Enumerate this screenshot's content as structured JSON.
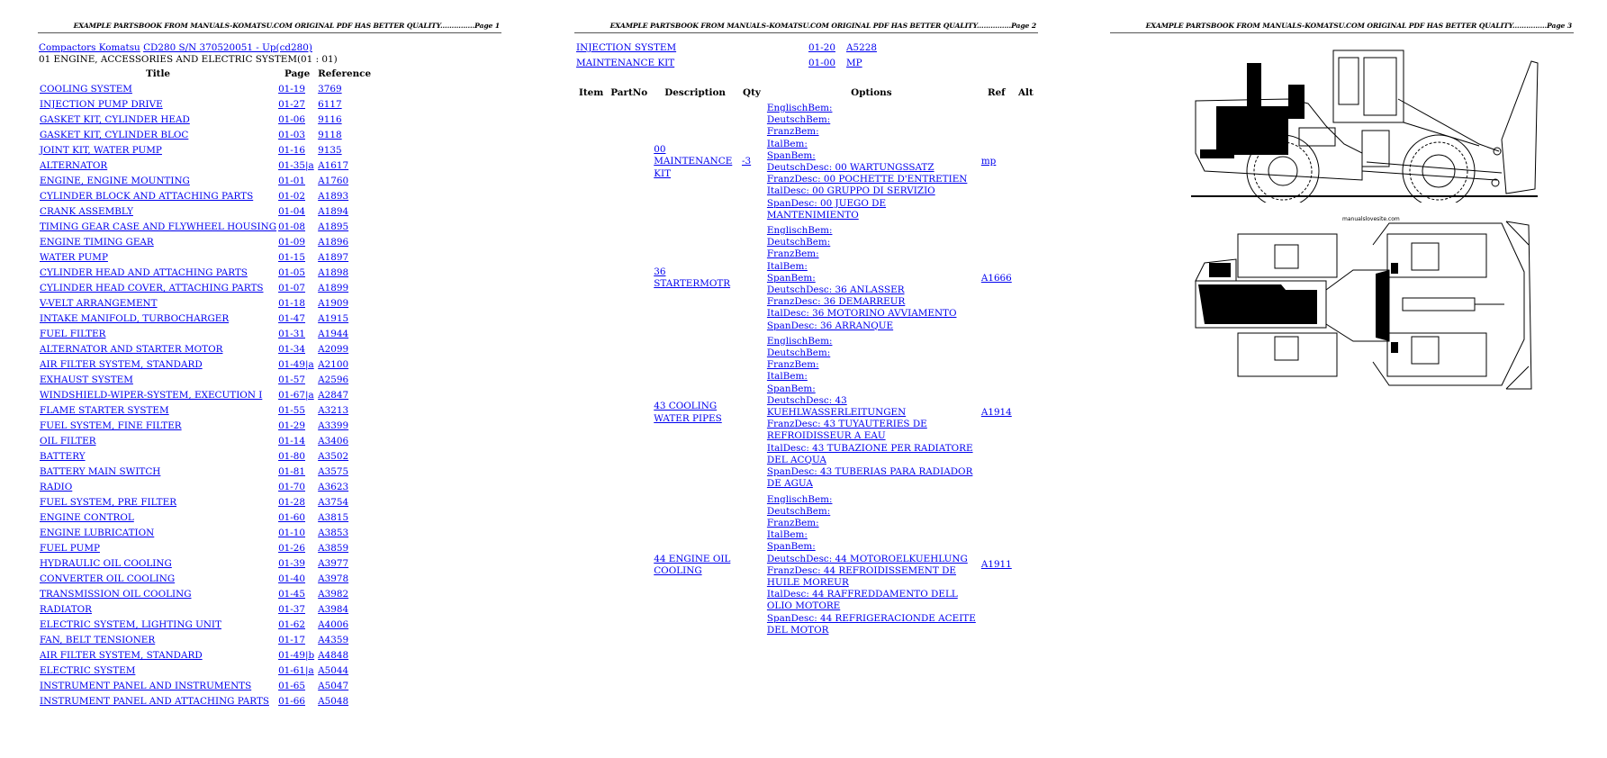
{
  "pages": [
    {
      "header": "EXAMPLE PARTSBOOK FROM MANUALS-KOMATSU.COM ORIGINAL PDF HAS BETTER QUALITY...............Page 1",
      "breadcrumb": {
        "category": "Compactors Komatsu",
        "model": "CD280 S/N 370520051 - Up(cd280)"
      },
      "section_title": "01 ENGINE, ACCESSORIES AND ELECTRIC SYSTEM(01 : 01)",
      "columns": {
        "title": "Title",
        "page": "Page",
        "reference": "Reference"
      },
      "rows": [
        {
          "title": "COOLING SYSTEM",
          "page": "01-19",
          "ref": "3769"
        },
        {
          "title": "INJECTION PUMP DRIVE",
          "page": "01-27",
          "ref": "6117"
        },
        {
          "title": "GASKET KIT, CYLINDER HEAD",
          "page": "01-06",
          "ref": "9116"
        },
        {
          "title": "GASKET KIT, CYLINDER BLOC",
          "page": "01-03",
          "ref": "9118"
        },
        {
          "title": "JOINT KIT, WATER PUMP",
          "page": "01-16",
          "ref": "9135"
        },
        {
          "title": "ALTERNATOR",
          "page": "01-35|a",
          "ref": "A1617"
        },
        {
          "title": "ENGINE, ENGINE MOUNTING",
          "page": "01-01",
          "ref": "A1760"
        },
        {
          "title": "CYLINDER BLOCK AND ATTACHING PARTS",
          "page": "01-02",
          "ref": "A1893"
        },
        {
          "title": "CRANK ASSEMBLY",
          "page": "01-04",
          "ref": "A1894"
        },
        {
          "title": "TIMING GEAR CASE AND FLYWHEEL HOUSING",
          "page": "01-08",
          "ref": "A1895"
        },
        {
          "title": "ENGINE TIMING GEAR",
          "page": "01-09",
          "ref": "A1896"
        },
        {
          "title": "WATER PUMP",
          "page": "01-15",
          "ref": "A1897"
        },
        {
          "title": "CYLINDER HEAD AND ATTACHING PARTS",
          "page": "01-05",
          "ref": "A1898"
        },
        {
          "title": "CYLINDER HEAD COVER, ATTACHING PARTS",
          "page": "01-07",
          "ref": "A1899"
        },
        {
          "title": "V-VELT ARRANGEMENT",
          "page": "01-18",
          "ref": "A1909"
        },
        {
          "title": "INTAKE MANIFOLD, TURBOCHARGER",
          "page": "01-47",
          "ref": "A1915"
        },
        {
          "title": "FUEL FILTER",
          "page": "01-31",
          "ref": "A1944"
        },
        {
          "title": "ALTERNATOR AND STARTER MOTOR",
          "page": "01-34",
          "ref": "A2099"
        },
        {
          "title": "AIR FILTER SYSTEM, STANDARD",
          "page": "01-49|a",
          "ref": "A2100"
        },
        {
          "title": "EXHAUST SYSTEM",
          "page": "01-57",
          "ref": "A2596"
        },
        {
          "title": "WINDSHIELD-WIPER-SYSTEM, EXECUTION I",
          "page": "01-67|a",
          "ref": "A2847"
        },
        {
          "title": "FLAME STARTER SYSTEM",
          "page": "01-55",
          "ref": "A3213"
        },
        {
          "title": "FUEL SYSTEM, FINE FILTER",
          "page": "01-29",
          "ref": "A3399"
        },
        {
          "title": "OIL FILTER",
          "page": "01-14",
          "ref": "A3406"
        },
        {
          "title": "BATTERY",
          "page": "01-80",
          "ref": "A3502"
        },
        {
          "title": "BATTERY MAIN SWITCH",
          "page": "01-81",
          "ref": "A3575"
        },
        {
          "title": "RADIO",
          "page": "01-70",
          "ref": "A3623"
        },
        {
          "title": "FUEL SYSTEM, PRE FILTER",
          "page": "01-28",
          "ref": "A3754"
        },
        {
          "title": "ENGINE CONTROL",
          "page": "01-60",
          "ref": "A3815"
        },
        {
          "title": "ENGINE LUBRICATION",
          "page": "01-10",
          "ref": "A3853"
        },
        {
          "title": "FUEL PUMP",
          "page": "01-26",
          "ref": "A3859"
        },
        {
          "title": "HYDRAULIC OIL COOLING",
          "page": "01-39",
          "ref": "A3977"
        },
        {
          "title": "CONVERTER OIL COOLING",
          "page": "01-40",
          "ref": "A3978"
        },
        {
          "title": "TRANSMISSION OIL COOLING",
          "page": "01-45",
          "ref": "A3982"
        },
        {
          "title": "RADIATOR",
          "page": "01-37",
          "ref": "A3984"
        },
        {
          "title": "ELECTRIC SYSTEM, LIGHTING UNIT",
          "page": "01-62",
          "ref": "A4006"
        },
        {
          "title": "FAN, BELT TENSIONER",
          "page": "01-17",
          "ref": "A4359"
        },
        {
          "title": "AIR FILTER SYSTEM, STANDARD",
          "page": "01-49|b",
          "ref": "A4848"
        },
        {
          "title": "ELECTRIC SYSTEM",
          "page": "01-61|a",
          "ref": "A5044"
        },
        {
          "title": "INSTRUMENT PANEL AND INSTRUMENTS",
          "page": "01-65",
          "ref": "A5047"
        },
        {
          "title": "INSTRUMENT PANEL AND ATTACHING PARTS",
          "page": "01-66",
          "ref": "A5048"
        }
      ]
    },
    {
      "header": "EXAMPLE PARTSBOOK FROM MANUALS-KOMATSU.COM ORIGINAL PDF HAS BETTER QUALITY...............Page 2",
      "rows": [
        {
          "title": "INJECTION SYSTEM",
          "page": "01-20",
          "ref": "A5228"
        },
        {
          "title": "MAINTENANCE KIT",
          "page": "01-00",
          "ref": "MP"
        }
      ],
      "parts_columns": {
        "item": "Item",
        "partno": "PartNo",
        "description": "Description",
        "qty": "Qty",
        "options": "Options",
        "ref": "Ref",
        "alt": "Alt"
      },
      "parts": [
        {
          "item": "",
          "partno": "",
          "description": "00 MAINTENANCE KIT",
          "qty": "-3",
          "options": [
            "EnglischBem:",
            "DeutschBem:",
            "FranzBem:",
            "ItalBem:",
            "SpanBem:",
            "DeutschDesc: 00 WARTUNGSSATZ",
            "FranzDesc: 00 POCHETTE D'ENTRETIEN",
            "ItalDesc: 00 GRUPPO DI SERVIZIO",
            "SpanDesc: 00 JUEGO DE",
            "MANTENIMIENTO"
          ],
          "ref": "mp",
          "alt": ""
        },
        {
          "item": "",
          "partno": "",
          "description": "36 STARTERMOTR",
          "qty": "",
          "options": [
            "EnglischBem:",
            "DeutschBem:",
            "FranzBem:",
            "ItalBem:",
            "SpanBem:",
            "DeutschDesc: 36 ANLASSER",
            "FranzDesc: 36 DEMARREUR",
            "ItalDesc: 36 MOTORINO AVVIAMENTO",
            "SpanDesc: 36 ARRANQUE"
          ],
          "ref": "A1666",
          "alt": ""
        },
        {
          "item": "",
          "partno": "",
          "description": "43 COOLING WATER PIPES",
          "qty": "",
          "options": [
            "EnglischBem:",
            "DeutschBem:",
            "FranzBem:",
            "ItalBem:",
            "SpanBem:",
            "DeutschDesc: 43",
            "KUEHLWASSERLEITUNGEN",
            "FranzDesc: 43 TUYAUTERIES DE",
            "REFROIDISSEUR A EAU",
            "ItalDesc: 43 TUBAZIONE PER RADIATORE",
            "DEL ACQUA",
            "SpanDesc: 43 TUBERIAS PARA RADIADOR",
            "DE AGUA"
          ],
          "ref": "A1914",
          "alt": ""
        },
        {
          "item": "",
          "partno": "",
          "description": "44 ENGINE OIL COOLING",
          "qty": "",
          "options": [
            "EnglischBem:",
            "DeutschBem:",
            "FranzBem:",
            "ItalBem:",
            "SpanBem:",
            "DeutschDesc: 44 MOTOROELKUEHLUNG",
            "FranzDesc: 44 REFROIDISSEMENT DE",
            "HUILE MOREUR",
            "ItalDesc: 44 RAFFREDDAMENTO DELL",
            "OLIO MOTORE",
            "SpanDesc: 44 REFRIGERACIONDE ACEITE",
            "DEL MOTOR"
          ],
          "ref": "A1911",
          "alt": ""
        }
      ]
    },
    {
      "header": "EXAMPLE PARTSBOOK FROM MANUALS-KOMATSU.COM ORIGINAL PDF HAS BETTER QUALITY...............Page 3",
      "drawings": [
        {
          "name": "side-view",
          "description": "Compactor side elevation line drawing"
        },
        {
          "name": "top-view",
          "description": "Compactor plan view line drawing",
          "watermark": "manualslovesite.com"
        }
      ]
    }
  ],
  "colors": {
    "link": "#0000ee",
    "text": "#000000",
    "rule": "#555555"
  }
}
